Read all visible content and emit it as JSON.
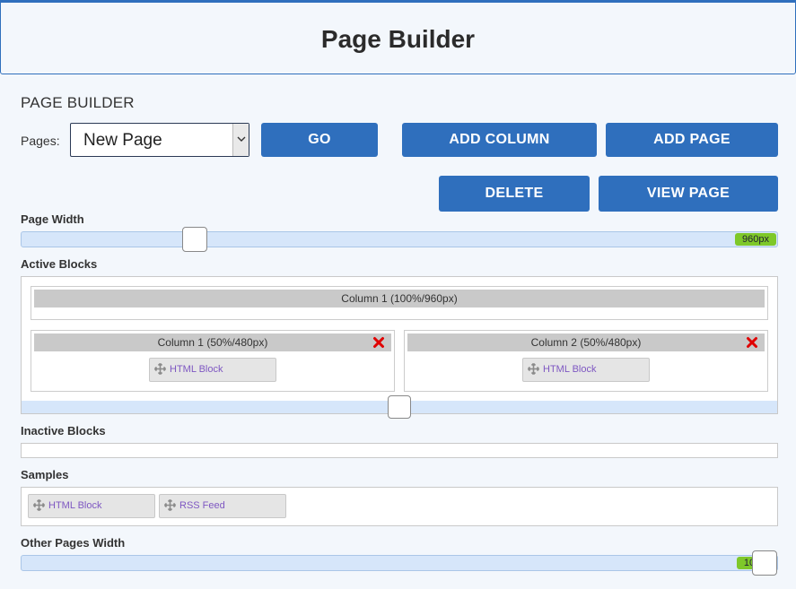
{
  "header": {
    "title": "Page Builder"
  },
  "builder": {
    "section_title": "PAGE BUILDER",
    "pages_label": "Pages:",
    "pages_select": {
      "value": "New Page"
    },
    "buttons": {
      "go": "GO",
      "add_column": "ADD COLUMN",
      "add_page": "ADD PAGE",
      "delete": "DELETE",
      "view_page": "VIEW PAGE"
    }
  },
  "page_width": {
    "label": "Page Width",
    "value": "960px",
    "fraction": 0.22
  },
  "active_blocks": {
    "label": "Active Blocks",
    "rows": [
      {
        "columns": [
          {
            "title": "Column 1 (100%/960px)",
            "blocks": []
          }
        ]
      },
      {
        "columns": [
          {
            "title": "Column 1 (50%/480px)",
            "blocks": [
              "HTML Block"
            ]
          },
          {
            "title": "Column 2 (50%/480px)",
            "blocks": [
              "HTML Block"
            ]
          }
        ]
      }
    ],
    "split_fraction": 0.5
  },
  "inactive_blocks": {
    "label": "Inactive Blocks"
  },
  "samples": {
    "label": "Samples",
    "items": [
      "HTML Block",
      "RSS Feed"
    ]
  },
  "other_pages_width": {
    "label": "Other Pages Width",
    "value": "100%",
    "fraction": 1.0
  },
  "colors": {
    "primary": "#2f6fbd",
    "badge": "#7ec82a",
    "block_text": "#7e57c2",
    "remove": "#e00000"
  },
  "icons": {
    "move": "move-arrows-icon",
    "remove": "close-x-icon",
    "dropdown": "chevron-down-icon"
  }
}
